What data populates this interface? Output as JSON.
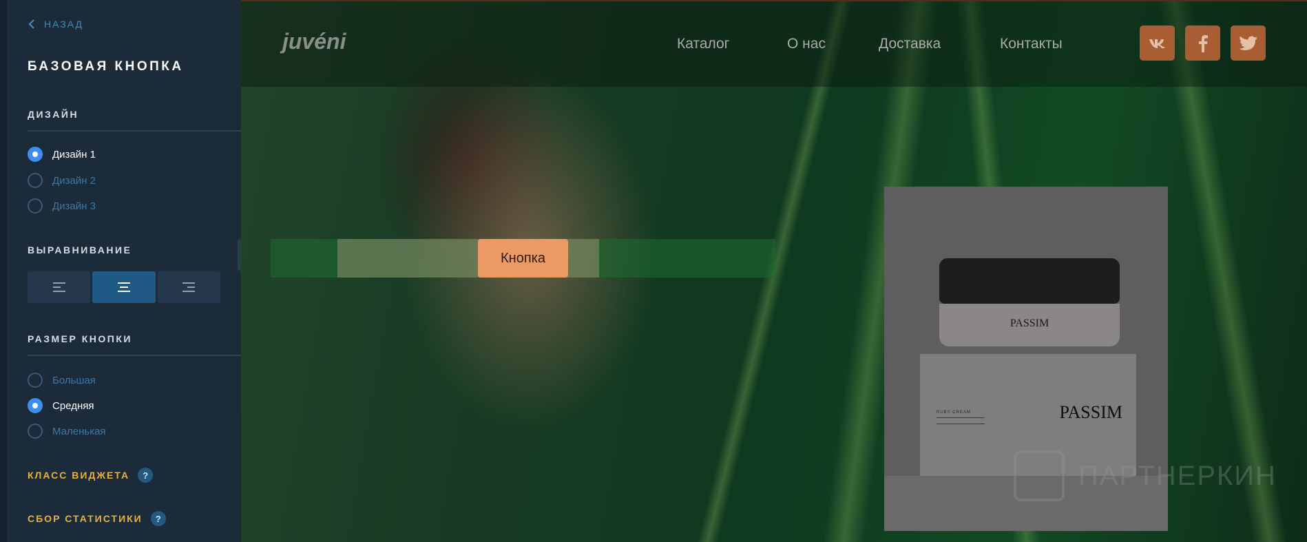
{
  "sidebar": {
    "back_label": "НАЗАД",
    "title": "БАЗОВАЯ КНОПКА",
    "design": {
      "label": "ДИЗАЙН",
      "options": [
        {
          "label": "Дизайн 1",
          "selected": true
        },
        {
          "label": "Дизайн 2",
          "selected": false
        },
        {
          "label": "Дизайн 3",
          "selected": false
        }
      ]
    },
    "alignment": {
      "label": "ВЫРАВНИВАНИЕ",
      "options": [
        "left",
        "center",
        "right"
      ],
      "selected": "center"
    },
    "size": {
      "label": "РАЗМЕР КНОПКИ",
      "options": [
        {
          "label": "Большая",
          "selected": false
        },
        {
          "label": "Средняя",
          "selected": true
        },
        {
          "label": "Маленькая",
          "selected": false
        }
      ]
    },
    "widget_class_label": "КЛАСС ВИДЖЕТА",
    "stats_label": "СБОР СТАТИСТИКИ",
    "help_glyph": "?"
  },
  "preview": {
    "logo": "juvéni",
    "nav": [
      "Каталог",
      "О нас",
      "Доставка",
      "Контакты"
    ],
    "social": [
      {
        "name": "vk-icon",
        "glyph": "vk"
      },
      {
        "name": "facebook-icon",
        "glyph": "f"
      },
      {
        "name": "twitter-icon",
        "glyph": "tw"
      }
    ],
    "button_label": "Кнопка",
    "product": {
      "jar_brand": "PASSIM",
      "box_brand": "PASSIM",
      "box_small": "RUBY CREAM"
    },
    "watermark": "ПАРТНЕРКИН"
  },
  "colors": {
    "accent_blue": "#3d8ef0",
    "accent_gold": "#e8b23a",
    "button_orange": "#ec9a64",
    "social_bg": "#a85d32"
  }
}
